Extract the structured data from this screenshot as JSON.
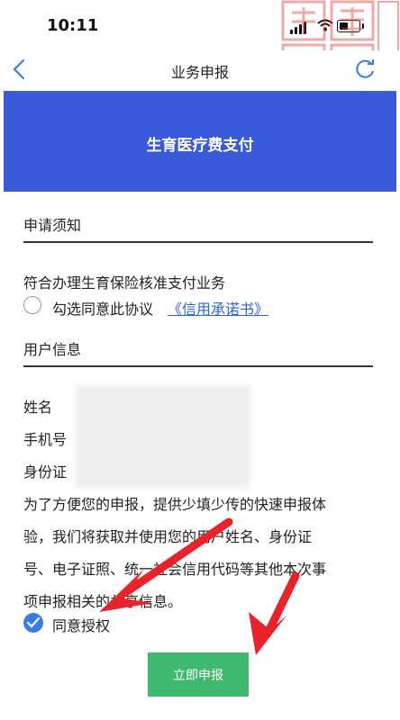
{
  "status_bar": {
    "time": "10:11"
  },
  "nav": {
    "title": "业务申报"
  },
  "banner": {
    "title": "生育医疗费支付"
  },
  "application_notice": {
    "heading": "申请须知",
    "description": "符合办理生育保险核准支付业务",
    "agree_text": "勾选同意此协议",
    "agreement_link": "《信用承诺书》"
  },
  "user_info": {
    "heading": "用户信息",
    "fields": [
      {
        "label": "姓名"
      },
      {
        "label": "手机号"
      },
      {
        "label": "身份证"
      }
    ],
    "notice_lines": [
      "为了方便您的申报，提供少填少传的快速申报体",
      "验，我们将获取并使用您的用户姓名、身份证",
      "号、电子证照、统一社会信用代码等其他本次事",
      "项申报相关的共享信息。"
    ],
    "authorize_label": "同意授权"
  },
  "actions": {
    "submit_label": "立即申报"
  },
  "colors": {
    "banner": "#3a5bd9",
    "submit": "#3fb870",
    "link": "#2f64d6",
    "checkbox": "#3a7be6",
    "arrow": "#e8232b"
  }
}
